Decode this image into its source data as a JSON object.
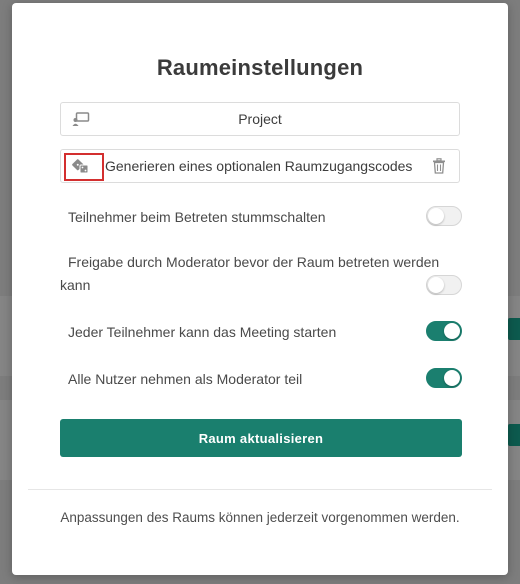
{
  "dialog": {
    "title": "Raumeinstellungen",
    "room_name": {
      "value": "Project",
      "icon": "room-presentation-icon"
    },
    "access_code": {
      "value": "Generieren eines optionalen Raumzugangscodes",
      "icon": "dice-icon",
      "delete_icon": "trash-icon"
    },
    "options": [
      {
        "label": "Teilnehmer beim Betreten stummschalten",
        "enabled": false
      },
      {
        "label": "Freigabe durch Moderator bevor der Raum betreten werden kann",
        "enabled": false
      },
      {
        "label": "Jeder Teilnehmer kann das Meeting starten",
        "enabled": true
      },
      {
        "label": "Alle Nutzer nehmen als Moderator teil",
        "enabled": true
      }
    ],
    "update_button": "Raum aktualisieren",
    "footer_note": "Anpassungen des Raums können jederzeit vorgenommen werden."
  },
  "colors": {
    "accent": "#1a7f6e",
    "highlight": "#d32f2f"
  }
}
